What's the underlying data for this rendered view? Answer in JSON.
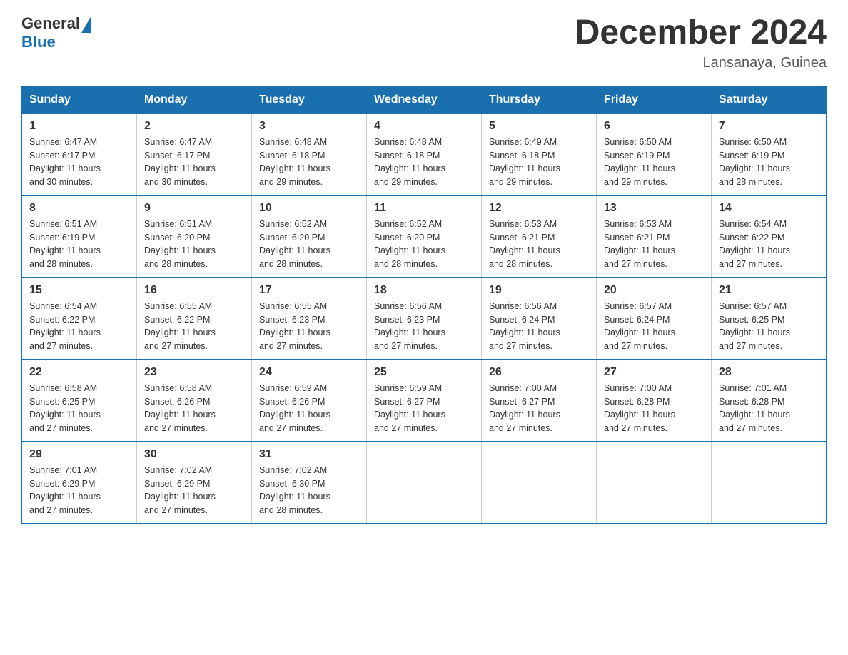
{
  "header": {
    "logo": {
      "general": "General",
      "blue": "Blue"
    },
    "title": "December 2024",
    "subtitle": "Lansanaya, Guinea"
  },
  "calendar": {
    "days_of_week": [
      "Sunday",
      "Monday",
      "Tuesday",
      "Wednesday",
      "Thursday",
      "Friday",
      "Saturday"
    ],
    "weeks": [
      [
        {
          "day": "1",
          "info": "Sunrise: 6:47 AM\nSunset: 6:17 PM\nDaylight: 11 hours\nand 30 minutes."
        },
        {
          "day": "2",
          "info": "Sunrise: 6:47 AM\nSunset: 6:17 PM\nDaylight: 11 hours\nand 30 minutes."
        },
        {
          "day": "3",
          "info": "Sunrise: 6:48 AM\nSunset: 6:18 PM\nDaylight: 11 hours\nand 29 minutes."
        },
        {
          "day": "4",
          "info": "Sunrise: 6:48 AM\nSunset: 6:18 PM\nDaylight: 11 hours\nand 29 minutes."
        },
        {
          "day": "5",
          "info": "Sunrise: 6:49 AM\nSunset: 6:18 PM\nDaylight: 11 hours\nand 29 minutes."
        },
        {
          "day": "6",
          "info": "Sunrise: 6:50 AM\nSunset: 6:19 PM\nDaylight: 11 hours\nand 29 minutes."
        },
        {
          "day": "7",
          "info": "Sunrise: 6:50 AM\nSunset: 6:19 PM\nDaylight: 11 hours\nand 28 minutes."
        }
      ],
      [
        {
          "day": "8",
          "info": "Sunrise: 6:51 AM\nSunset: 6:19 PM\nDaylight: 11 hours\nand 28 minutes."
        },
        {
          "day": "9",
          "info": "Sunrise: 6:51 AM\nSunset: 6:20 PM\nDaylight: 11 hours\nand 28 minutes."
        },
        {
          "day": "10",
          "info": "Sunrise: 6:52 AM\nSunset: 6:20 PM\nDaylight: 11 hours\nand 28 minutes."
        },
        {
          "day": "11",
          "info": "Sunrise: 6:52 AM\nSunset: 6:20 PM\nDaylight: 11 hours\nand 28 minutes."
        },
        {
          "day": "12",
          "info": "Sunrise: 6:53 AM\nSunset: 6:21 PM\nDaylight: 11 hours\nand 28 minutes."
        },
        {
          "day": "13",
          "info": "Sunrise: 6:53 AM\nSunset: 6:21 PM\nDaylight: 11 hours\nand 27 minutes."
        },
        {
          "day": "14",
          "info": "Sunrise: 6:54 AM\nSunset: 6:22 PM\nDaylight: 11 hours\nand 27 minutes."
        }
      ],
      [
        {
          "day": "15",
          "info": "Sunrise: 6:54 AM\nSunset: 6:22 PM\nDaylight: 11 hours\nand 27 minutes."
        },
        {
          "day": "16",
          "info": "Sunrise: 6:55 AM\nSunset: 6:22 PM\nDaylight: 11 hours\nand 27 minutes."
        },
        {
          "day": "17",
          "info": "Sunrise: 6:55 AM\nSunset: 6:23 PM\nDaylight: 11 hours\nand 27 minutes."
        },
        {
          "day": "18",
          "info": "Sunrise: 6:56 AM\nSunset: 6:23 PM\nDaylight: 11 hours\nand 27 minutes."
        },
        {
          "day": "19",
          "info": "Sunrise: 6:56 AM\nSunset: 6:24 PM\nDaylight: 11 hours\nand 27 minutes."
        },
        {
          "day": "20",
          "info": "Sunrise: 6:57 AM\nSunset: 6:24 PM\nDaylight: 11 hours\nand 27 minutes."
        },
        {
          "day": "21",
          "info": "Sunrise: 6:57 AM\nSunset: 6:25 PM\nDaylight: 11 hours\nand 27 minutes."
        }
      ],
      [
        {
          "day": "22",
          "info": "Sunrise: 6:58 AM\nSunset: 6:25 PM\nDaylight: 11 hours\nand 27 minutes."
        },
        {
          "day": "23",
          "info": "Sunrise: 6:58 AM\nSunset: 6:26 PM\nDaylight: 11 hours\nand 27 minutes."
        },
        {
          "day": "24",
          "info": "Sunrise: 6:59 AM\nSunset: 6:26 PM\nDaylight: 11 hours\nand 27 minutes."
        },
        {
          "day": "25",
          "info": "Sunrise: 6:59 AM\nSunset: 6:27 PM\nDaylight: 11 hours\nand 27 minutes."
        },
        {
          "day": "26",
          "info": "Sunrise: 7:00 AM\nSunset: 6:27 PM\nDaylight: 11 hours\nand 27 minutes."
        },
        {
          "day": "27",
          "info": "Sunrise: 7:00 AM\nSunset: 6:28 PM\nDaylight: 11 hours\nand 27 minutes."
        },
        {
          "day": "28",
          "info": "Sunrise: 7:01 AM\nSunset: 6:28 PM\nDaylight: 11 hours\nand 27 minutes."
        }
      ],
      [
        {
          "day": "29",
          "info": "Sunrise: 7:01 AM\nSunset: 6:29 PM\nDaylight: 11 hours\nand 27 minutes."
        },
        {
          "day": "30",
          "info": "Sunrise: 7:02 AM\nSunset: 6:29 PM\nDaylight: 11 hours\nand 27 minutes."
        },
        {
          "day": "31",
          "info": "Sunrise: 7:02 AM\nSunset: 6:30 PM\nDaylight: 11 hours\nand 28 minutes."
        },
        {
          "day": "",
          "info": ""
        },
        {
          "day": "",
          "info": ""
        },
        {
          "day": "",
          "info": ""
        },
        {
          "day": "",
          "info": ""
        }
      ]
    ]
  }
}
